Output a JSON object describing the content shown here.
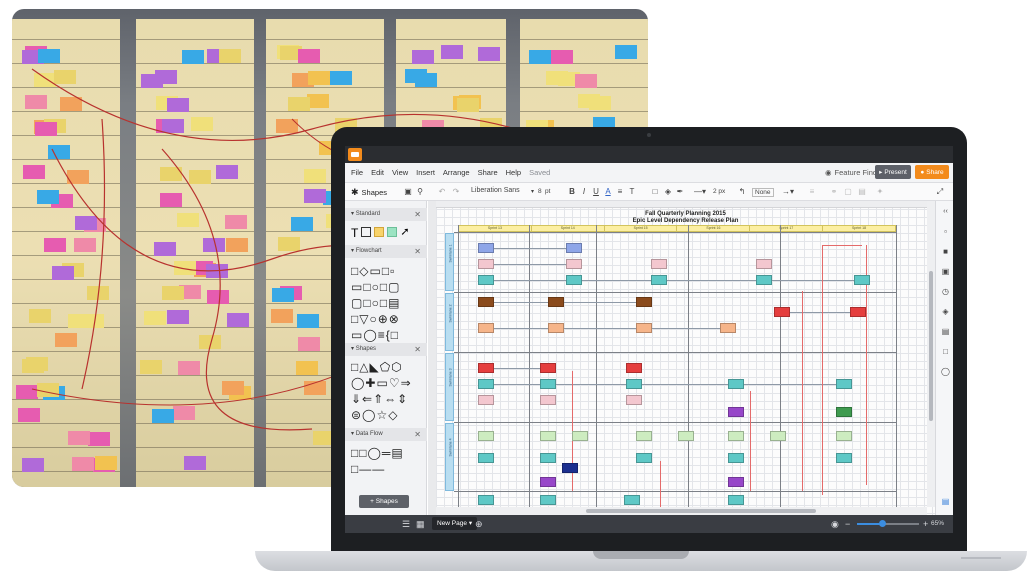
{
  "app": {
    "menu": [
      "File",
      "Edit",
      "View",
      "Insert",
      "Arrange",
      "Share",
      "Help"
    ],
    "saved_label": "Saved",
    "feature_find_label": "Feature Find",
    "present_label": "Present",
    "share_label": "Share"
  },
  "toolbar": {
    "shapes_label": "Shapes",
    "font_name": "Liberation Sans",
    "font_size": "8",
    "font_unit": "pt",
    "line_width": "2 px",
    "line_end": "None"
  },
  "left_panel": {
    "sections": [
      {
        "title": "Standard"
      },
      {
        "title": "Flowchart"
      },
      {
        "title": "Shapes"
      },
      {
        "title": "Data Flow"
      }
    ],
    "add_shapes_label": "+ Shapes"
  },
  "document": {
    "title_line1": "Fall Quarterly Planning 2015",
    "title_line2": "Epic Level Dependency Release Plan",
    "sprints": [
      "Sprint 13",
      "Sprint 14",
      "Sprint 15",
      "Sprint 16",
      "Sprint 17",
      "Sprint 18"
    ],
    "lanes": [
      "Swimlane 1",
      "Swimlane 2",
      "Swimlane 3",
      "Swimlane 4"
    ]
  },
  "bottom_bar": {
    "new_page_label": "New Page",
    "zoom_value": "65%",
    "zoom_fraction": 0.4
  },
  "colors": {
    "accent": "#f38b1c",
    "card_blue": "#8fa6e8",
    "card_pink": "#f3c7cf",
    "card_teal": "#5ec8c6",
    "card_brown": "#8b4b1c",
    "card_orange": "#f6b58a",
    "card_red": "#e53e3e",
    "card_green": "#3f9b4f",
    "card_lightgreen": "#cdecc0",
    "card_purple": "#9747c9",
    "card_navy": "#1c2f8f",
    "card_yellow": "#f4e96b"
  }
}
